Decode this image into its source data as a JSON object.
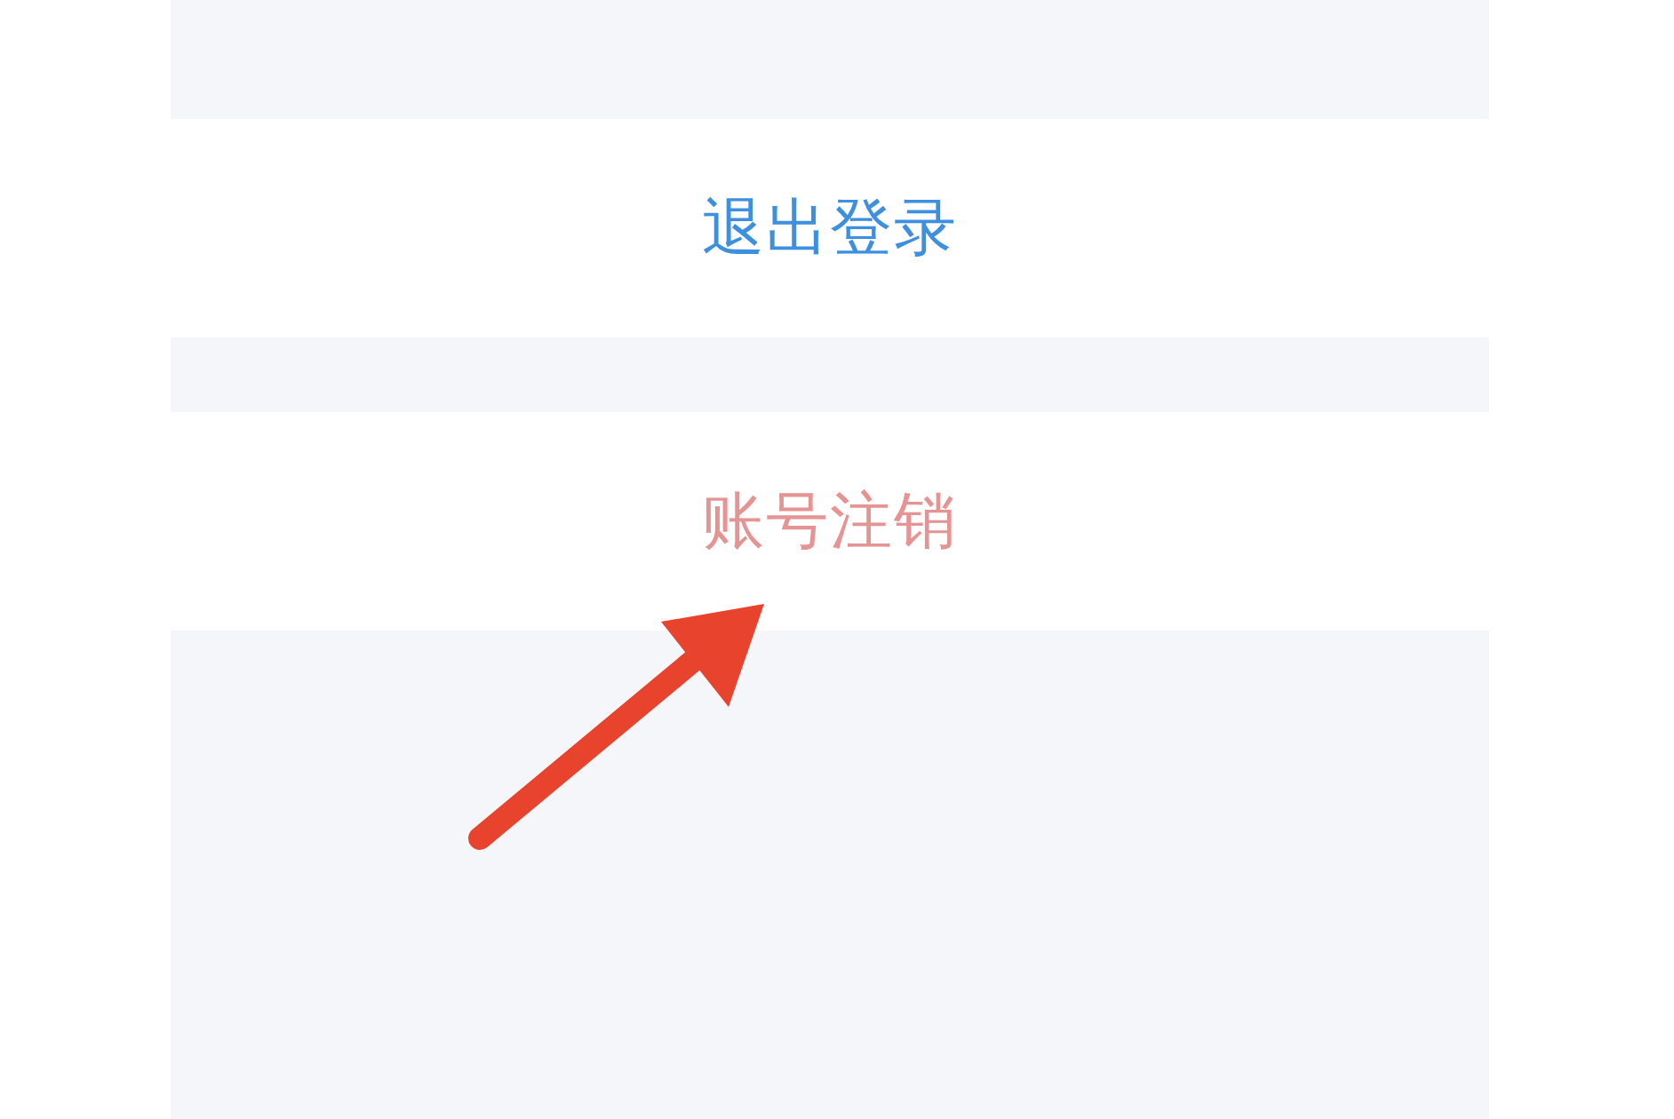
{
  "actions": [
    {
      "label": "退出登录",
      "kind": "normal"
    },
    {
      "label": "账号注销",
      "kind": "danger"
    }
  ]
}
